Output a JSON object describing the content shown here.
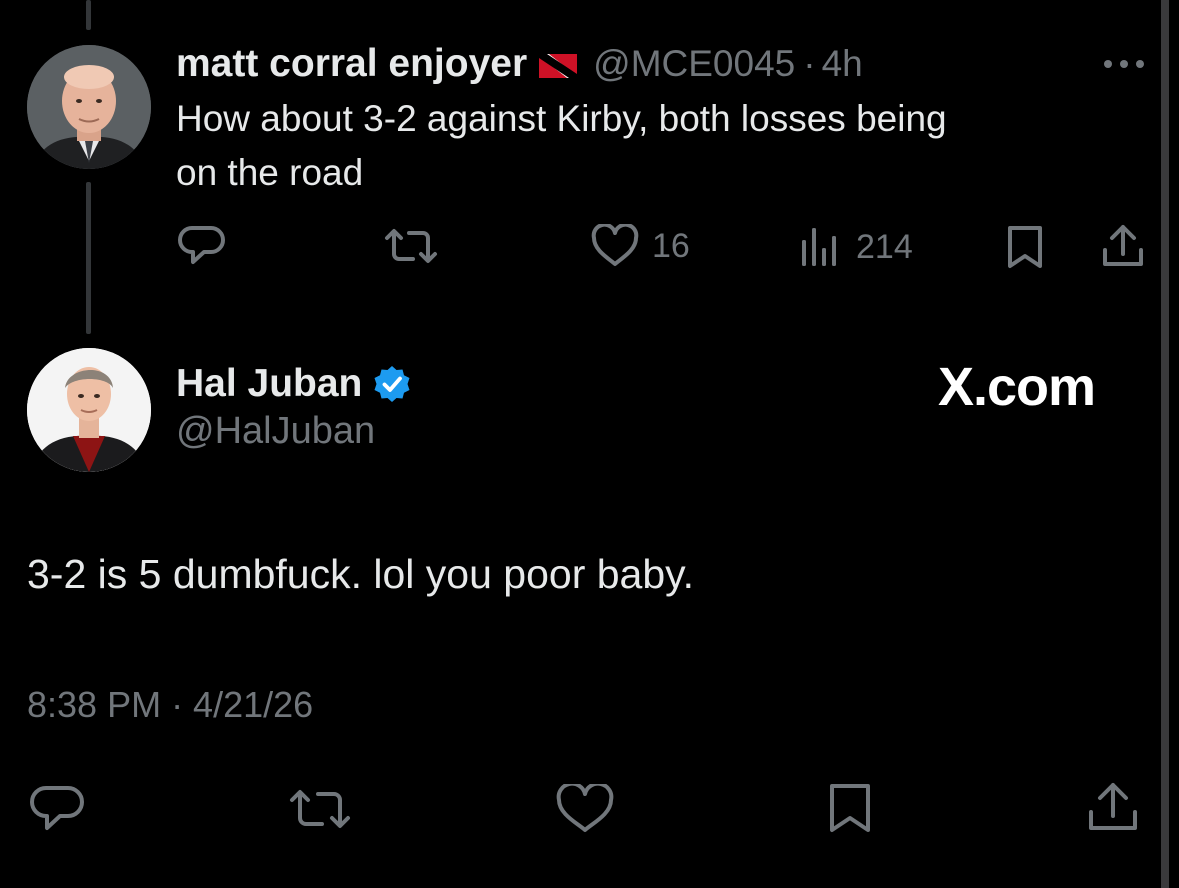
{
  "reply_tweet": {
    "display_name": "matt corral enjoyer",
    "flag_icon": "trinidad-and-tobago-flag",
    "handle": "@MCE0045",
    "separator": "·",
    "time_ago": "4h",
    "more_icon": "more-horizontal-icon",
    "text_line1": "How about 3-2 against Kirby, both losses being",
    "text_line2": "on the road",
    "actions": {
      "reply_icon": "reply-icon",
      "retweet_icon": "retweet-icon",
      "like_icon": "heart-icon",
      "like_count": "16",
      "views_icon": "views-icon",
      "view_count": "214",
      "bookmark_icon": "bookmark-icon",
      "share_icon": "share-icon"
    }
  },
  "main_tweet": {
    "display_name": "Hal Juban",
    "verified_icon": "verified-badge-icon",
    "handle": "@HalJuban",
    "watermark": "X.com",
    "text": "3-2 is 5 dumbfuck. lol you poor baby.",
    "timestamp": "8:38 PM · 4/21/26",
    "actions": {
      "reply_icon": "reply-icon",
      "retweet_icon": "retweet-icon",
      "like_icon": "heart-icon",
      "bookmark_icon": "bookmark-icon",
      "share_icon": "share-icon"
    }
  },
  "colors": {
    "background": "#000000",
    "primary_text": "#e7e9ea",
    "secondary_text": "#71767b",
    "verified_blue": "#1d9bf0",
    "thread_line": "#333639"
  }
}
